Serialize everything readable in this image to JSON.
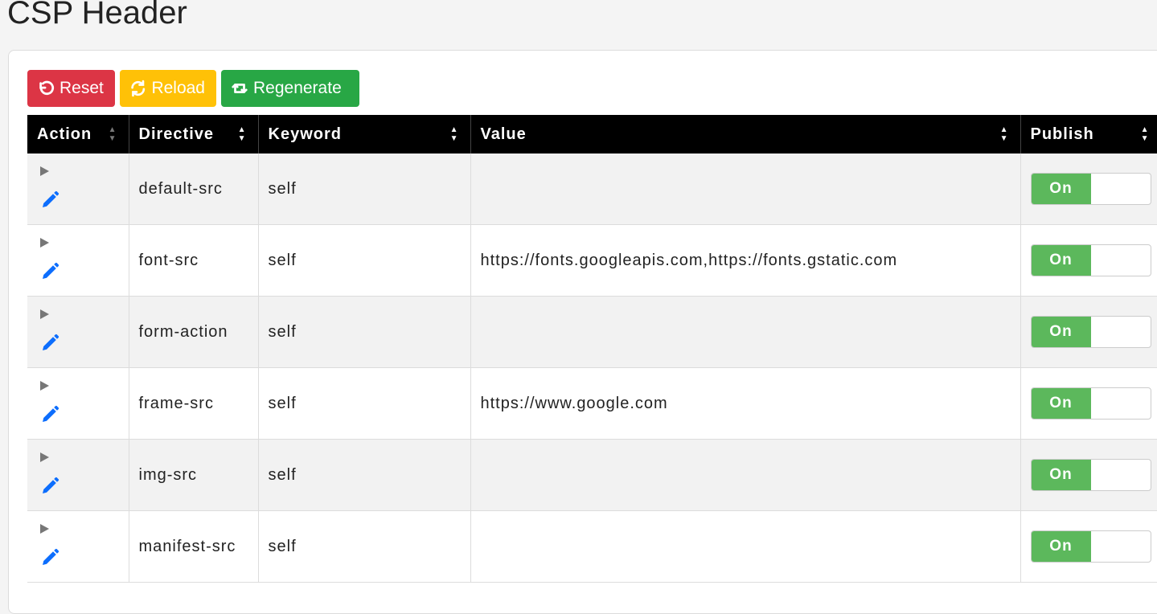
{
  "page": {
    "title": "CSP Header"
  },
  "toolbar": {
    "reset_label": "Reset",
    "reload_label": "Reload",
    "regenerate_label": "Regenerate"
  },
  "table": {
    "headers": {
      "action": "Action",
      "directive": "Directive",
      "keyword": "Keyword",
      "value": "Value",
      "publish": "Publish"
    },
    "rows": [
      {
        "directive": "default-src",
        "keyword": "self",
        "value": "",
        "publish": "On"
      },
      {
        "directive": "font-src",
        "keyword": "self",
        "value": "https://fonts.googleapis.com,https://fonts.gstatic.com",
        "publish": "On"
      },
      {
        "directive": "form-action",
        "keyword": "self",
        "value": "",
        "publish": "On"
      },
      {
        "directive": "frame-src",
        "keyword": "self",
        "value": "https://www.google.com",
        "publish": "On"
      },
      {
        "directive": "img-src",
        "keyword": "self",
        "value": "",
        "publish": "On"
      },
      {
        "directive": "manifest-src",
        "keyword": "self",
        "value": "",
        "publish": "On"
      }
    ]
  },
  "icons": {
    "reset": "undo-icon",
    "reload": "refresh-icon",
    "regenerate": "retweet-icon",
    "expand": "caret-right-icon",
    "edit": "pencil-icon",
    "sort": "sort-icon"
  },
  "colors": {
    "reset": "#dc3545",
    "reload": "#ffc107",
    "regenerate": "#28a745",
    "toggle_on": "#5cb85c",
    "edit_icon": "#0d6efd",
    "header_bg": "#000000"
  }
}
